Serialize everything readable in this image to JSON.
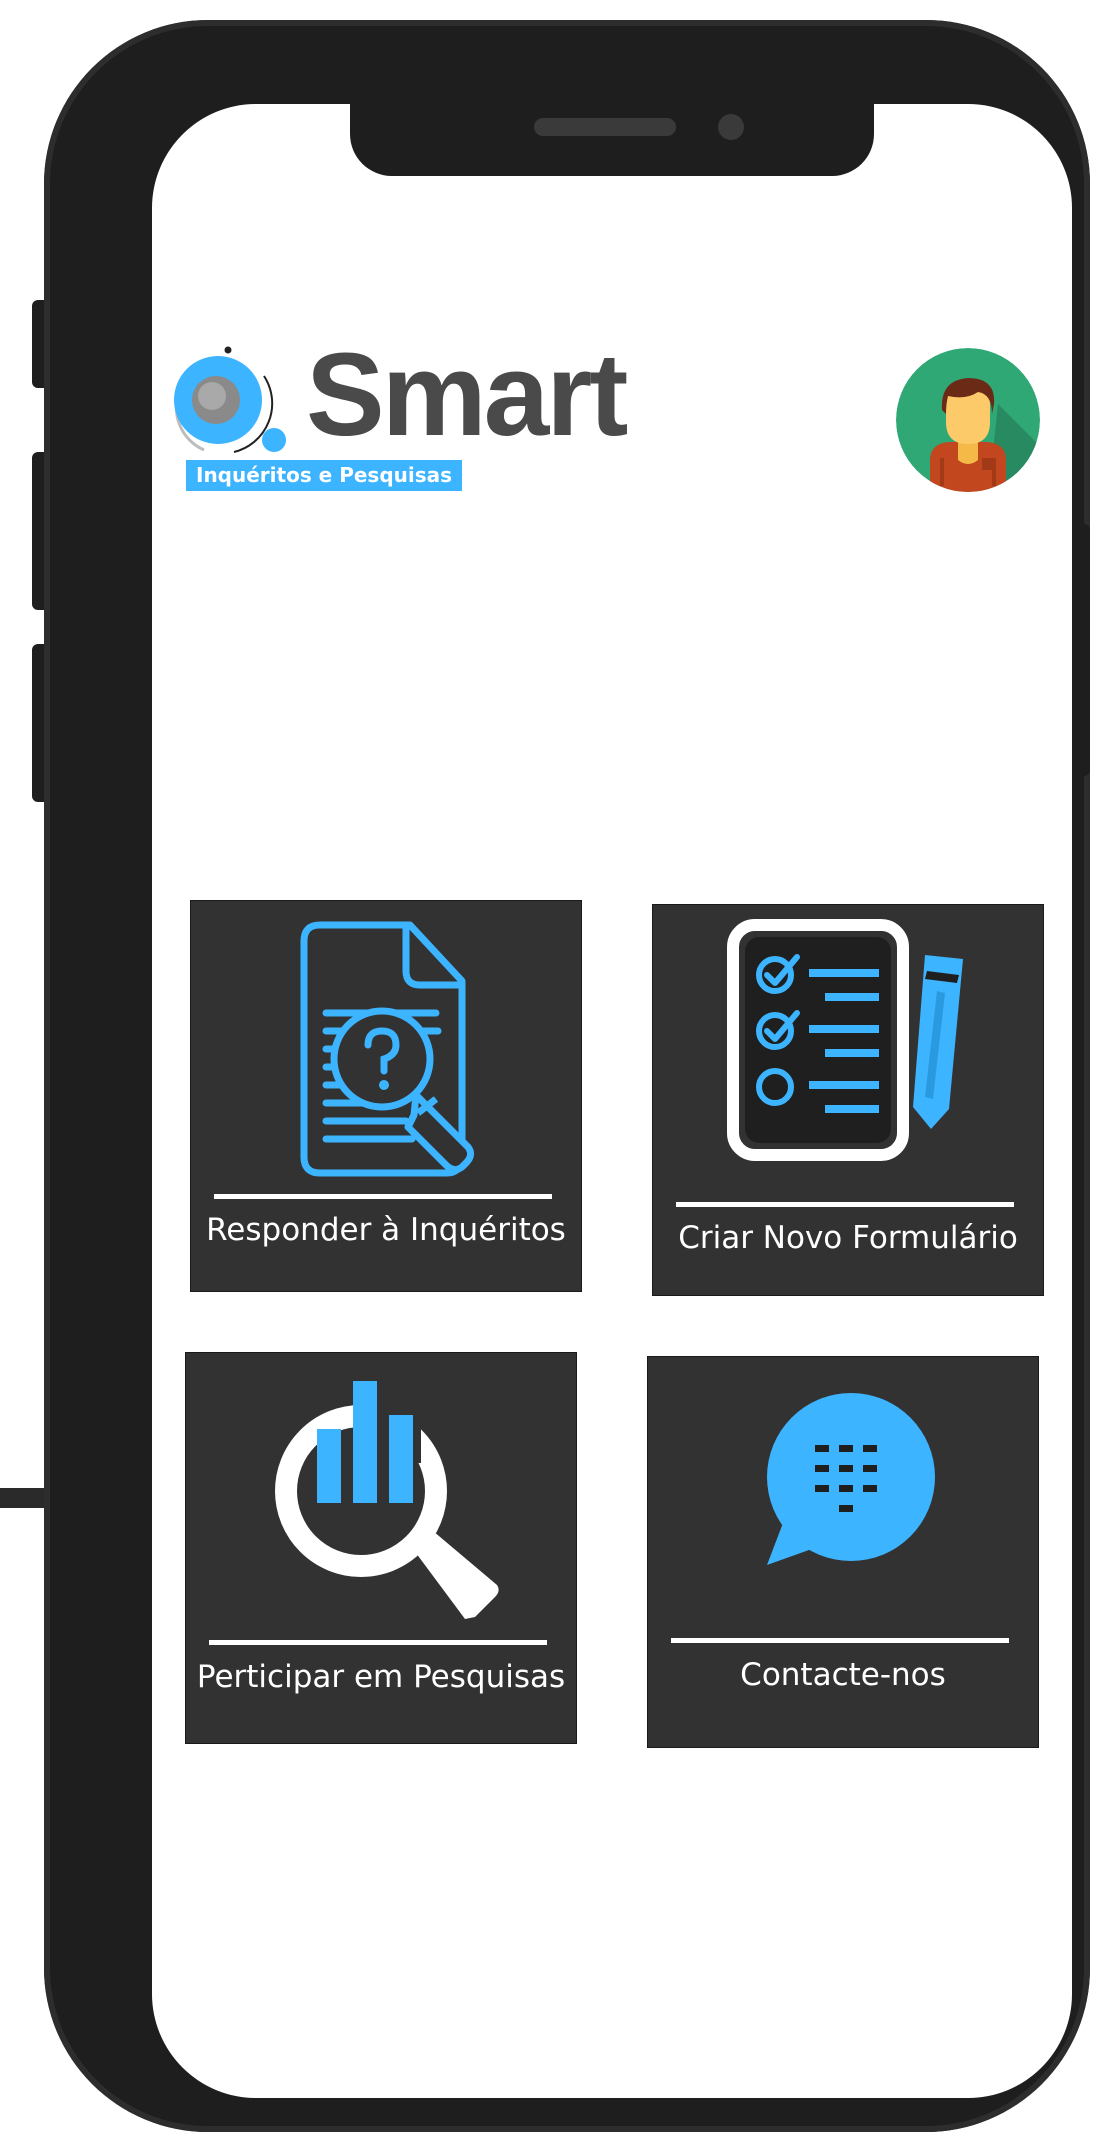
{
  "brand": {
    "name": "Smart",
    "tagline": "Inquéritos e Pesquisas",
    "logo_icon": "q-letter-logo-icon",
    "primary_color": "#3db4ff",
    "wordmark_color": "#4a4a4a"
  },
  "header": {
    "avatar_icon": "user-avatar-icon"
  },
  "menu": {
    "tiles": [
      {
        "label": "Responder à Inquéritos",
        "icon": "document-question-search-icon"
      },
      {
        "label": "Criar Novo  Formulário",
        "icon": "checklist-pencil-icon"
      },
      {
        "label": "Perticipar em Pesquisas",
        "icon": "bar-chart-magnifier-icon"
      },
      {
        "label": "Contacte-nos",
        "icon": "chat-bubble-keypad-icon"
      }
    ]
  },
  "colors": {
    "tile_background": "#323232",
    "accent": "#3db4ff",
    "phone_frame": "#1e1e1e"
  }
}
